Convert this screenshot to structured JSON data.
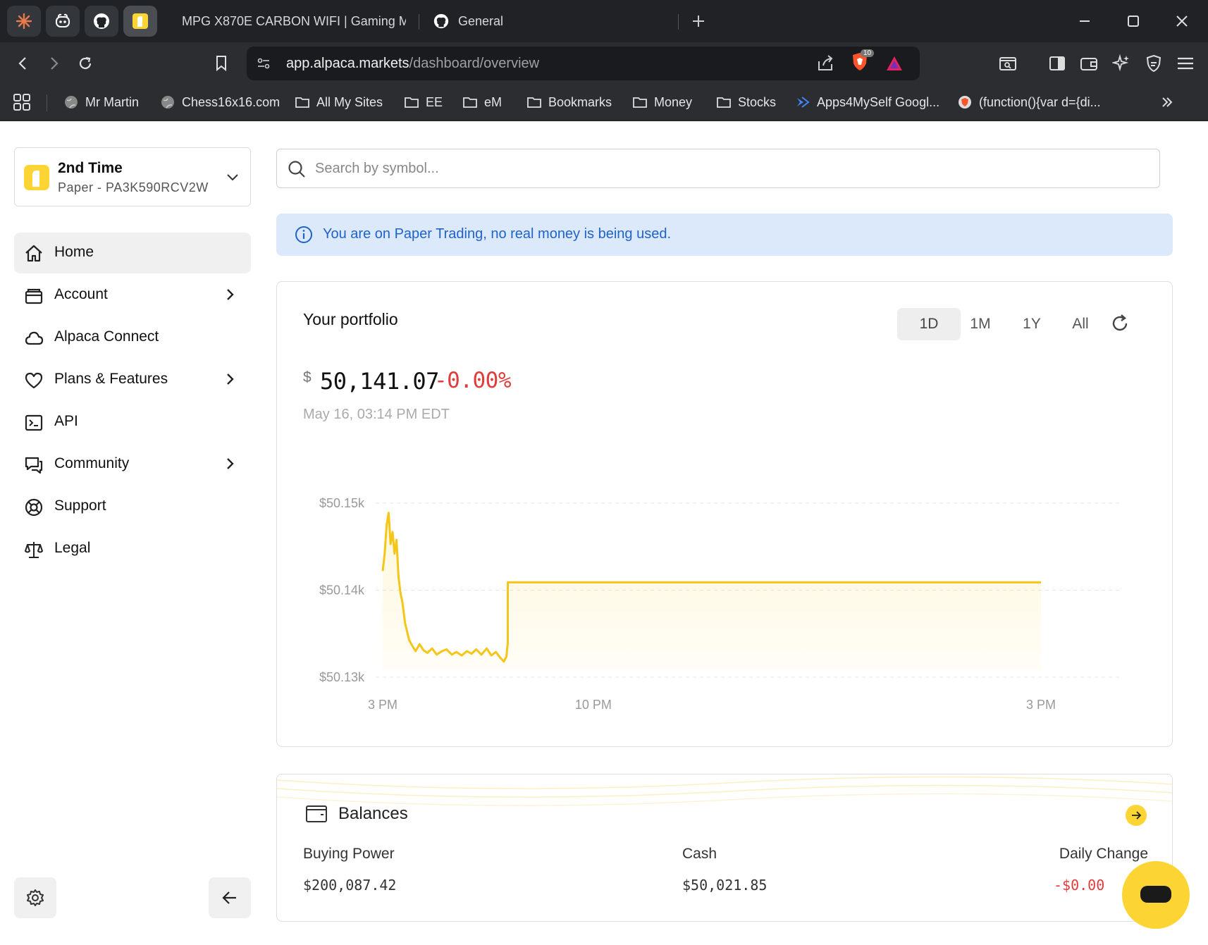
{
  "browser": {
    "tabs": [
      {
        "label": "MPG X870E CARBON WIFI | Gaming M"
      },
      {
        "label": "General"
      }
    ],
    "url": {
      "host": "app.alpaca.markets",
      "path": "/dashboard/overview"
    },
    "extension_badge": "10",
    "bookmarks": [
      {
        "label": "Mr Martin",
        "icon": "globe-icon"
      },
      {
        "label": "Chess16x16.com",
        "icon": "globe-icon"
      },
      {
        "label": "All My Sites",
        "icon": "folder-icon"
      },
      {
        "label": "EE",
        "icon": "folder-icon"
      },
      {
        "label": "eM",
        "icon": "folder-icon"
      },
      {
        "label": "Bookmarks",
        "icon": "folder-icon"
      },
      {
        "label": "Money",
        "icon": "folder-icon"
      },
      {
        "label": "Stocks",
        "icon": "folder-icon"
      },
      {
        "label": "Apps4MySelf Googl...",
        "icon": "apps-script-icon"
      },
      {
        "label": "(function(){var d={di...",
        "icon": "brave-icon"
      }
    ]
  },
  "account": {
    "name": "2nd Time",
    "subtitle": "Paper - PA3K590RCV2W"
  },
  "nav": [
    {
      "label": "Home",
      "icon": "home-icon",
      "has_submenu": false,
      "active": true
    },
    {
      "label": "Account",
      "icon": "wallet-icon",
      "has_submenu": true
    },
    {
      "label": "Alpaca Connect",
      "icon": "cloud-icon",
      "has_submenu": false
    },
    {
      "label": "Plans & Features",
      "icon": "heart-icon",
      "has_submenu": true
    },
    {
      "label": "API",
      "icon": "terminal-icon",
      "has_submenu": false
    },
    {
      "label": "Community",
      "icon": "chat-bubbles-icon",
      "has_submenu": true
    },
    {
      "label": "Support",
      "icon": "lifebuoy-icon",
      "has_submenu": false
    },
    {
      "label": "Legal",
      "icon": "scales-icon",
      "has_submenu": false
    }
  ],
  "search": {
    "placeholder": "Search by symbol..."
  },
  "notice": {
    "text": "You are on Paper Trading, no real money is being used."
  },
  "portfolio": {
    "title": "Your portfolio",
    "ranges": [
      "1D",
      "1M",
      "1Y",
      "All"
    ],
    "active_range": "1D",
    "currency_symbol": "$",
    "value": "50,141.07",
    "change": "-0.00%",
    "timestamp": "May 16, 03:14 PM EDT"
  },
  "chart_data": {
    "type": "area",
    "line_color": "#f5c518",
    "y_ticks": [
      "$50.15k",
      "$50.14k",
      "$50.13k"
    ],
    "x_ticks": [
      "3 PM",
      "10 PM",
      "3 PM"
    ],
    "ylim": [
      50130,
      50150
    ],
    "grid": true,
    "series": [
      {
        "x": [
          0,
          0.003,
          0.006,
          0.009,
          0.012,
          0.015,
          0.018,
          0.021,
          0.024,
          0.027,
          0.03,
          0.034,
          0.04,
          0.045,
          0.05,
          0.056,
          0.062,
          0.068,
          0.075,
          0.082,
          0.09,
          0.097,
          0.105,
          0.112,
          0.12,
          0.128,
          0.135,
          0.142,
          0.15,
          0.158,
          0.165,
          0.172,
          0.178,
          0.184,
          0.188,
          0.19,
          0.19,
          1.0
        ],
        "y": [
          50142.2,
          50144.2,
          50147.5,
          50148.9,
          50145.3,
          50146.7,
          50144.2,
          50145.8,
          50141.6,
          50139.7,
          50138.6,
          50136.2,
          50134.3,
          50133.6,
          50133.0,
          50133.8,
          50133.1,
          50132.8,
          50133.3,
          50132.6,
          50133.0,
          50133.2,
          50132.6,
          50132.9,
          50132.5,
          50133.0,
          50132.7,
          50133.2,
          50132.6,
          50133.3,
          50132.5,
          50132.9,
          50132.3,
          50131.8,
          50132.4,
          50134.0,
          50140.9,
          50140.9
        ]
      }
    ]
  },
  "balances": {
    "title": "Balances",
    "items": [
      {
        "label": "Buying Power",
        "value": "$200,087.42",
        "color": "#333333"
      },
      {
        "label": "Cash",
        "value": "$50,021.85",
        "color": "#333333"
      },
      {
        "label": "Daily Change",
        "value": "-$0.00",
        "color": "#e03c3c"
      }
    ]
  },
  "colors": {
    "accent": "#fcd535",
    "negative": "#e03c3c",
    "info": "#1f63c9"
  }
}
